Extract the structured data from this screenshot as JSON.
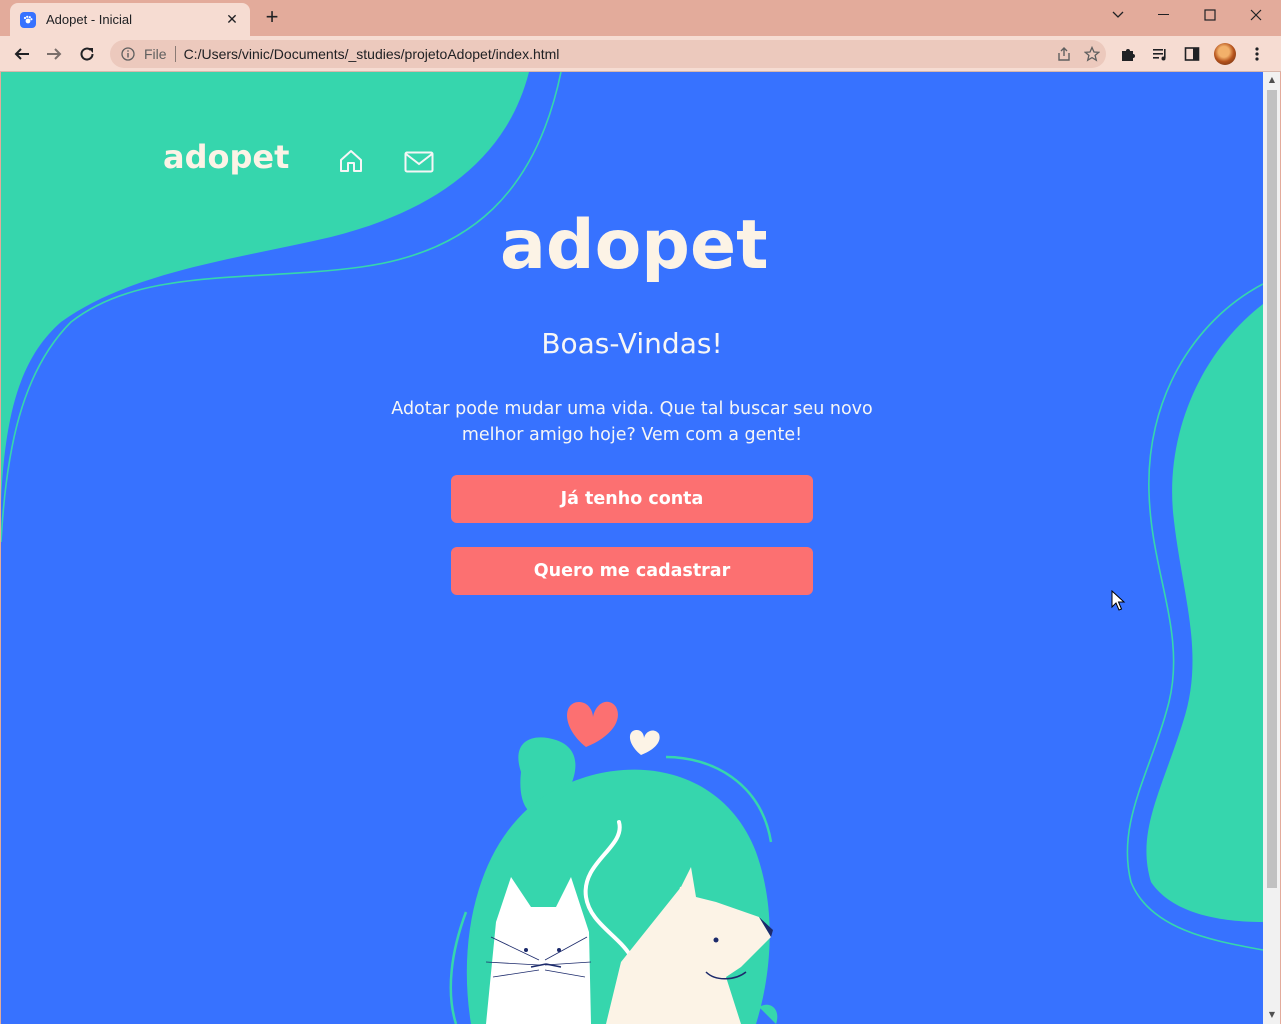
{
  "browser": {
    "tab_title": "Adopet - Inicial",
    "new_tab_label": "+",
    "url_scheme": "File",
    "url": "C:/Users/vinic/Documents/_studies/projetoAdopet/index.html"
  },
  "page": {
    "nav": {
      "logo_text": "adopet",
      "icons": [
        "home-icon",
        "mail-icon"
      ]
    },
    "hero": {
      "logo_text": "adopet",
      "title": "Boas-Vindas!",
      "description": "Adotar pode mudar uma vida. Que tal buscar seu novo melhor amigo hoje? Vem com a gente!",
      "login_button": "Já tenho conta",
      "signup_button": "Quero me cadastrar"
    }
  },
  "colors": {
    "background": "#3772ff",
    "accent_green": "#36d6ad",
    "button": "#fc7071",
    "text_light": "#f6f6f6",
    "logo_cream": "#fcf3e6",
    "browser_frame": "#e3ab9b"
  }
}
